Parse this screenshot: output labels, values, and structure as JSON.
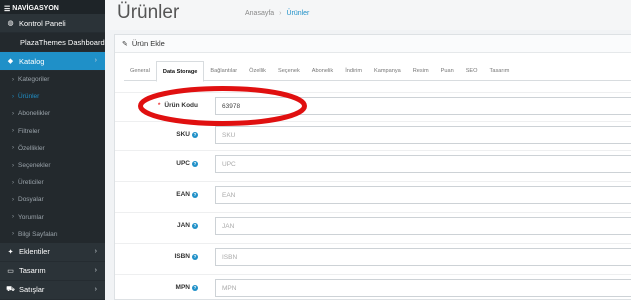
{
  "sidebar": {
    "header": "NAVİGASYON",
    "items": [
      {
        "label": "Kontrol Paneli"
      },
      {
        "label": "PlazaThemes Dashboard"
      },
      {
        "label": "Katalog"
      }
    ],
    "catalog_sub": [
      {
        "label": "Kategoriler"
      },
      {
        "label": "Ürünler"
      },
      {
        "label": "Abonelikler"
      },
      {
        "label": "Filtreler"
      },
      {
        "label": "Özellikler"
      },
      {
        "label": "Seçenekler"
      },
      {
        "label": "Üreticiler"
      },
      {
        "label": "Dosyalar"
      },
      {
        "label": "Yorumlar"
      },
      {
        "label": "Bilgi Sayfaları"
      }
    ],
    "bottom": [
      {
        "label": "Eklentiler"
      },
      {
        "label": "Tasarım"
      },
      {
        "label": "Satışlar"
      }
    ]
  },
  "header": {
    "title": "Ürünler",
    "breadcrumb_home": "Anasayfa",
    "breadcrumb_current": "Ürünler"
  },
  "panel": {
    "title": "Ürün Ekle"
  },
  "tabs": [
    {
      "label": "General"
    },
    {
      "label": "Data Storage"
    },
    {
      "label": "Bağlantılar"
    },
    {
      "label": "Özellik"
    },
    {
      "label": "Seçenek"
    },
    {
      "label": "Abonelik"
    },
    {
      "label": "İndirim"
    },
    {
      "label": "Kampanya"
    },
    {
      "label": "Resim"
    },
    {
      "label": "Puan"
    },
    {
      "label": "SEO"
    },
    {
      "label": "Tasarım"
    }
  ],
  "form": {
    "model": {
      "label": "Ürün Kodu",
      "value": "63978",
      "placeholder": "Ürün Kodu"
    },
    "sku": {
      "label": "SKU",
      "placeholder": "SKU"
    },
    "upc": {
      "label": "UPC",
      "placeholder": "UPC"
    },
    "ean": {
      "label": "EAN",
      "placeholder": "EAN"
    },
    "jan": {
      "label": "JAN",
      "placeholder": "JAN"
    },
    "isbn": {
      "label": "ISBN",
      "placeholder": "ISBN"
    },
    "mpn": {
      "label": "MPN",
      "placeholder": "MPN"
    }
  },
  "colors": {
    "accent": "#1f90c8",
    "sidebar_bg": "#2b3338",
    "annotation": "#e01010"
  }
}
